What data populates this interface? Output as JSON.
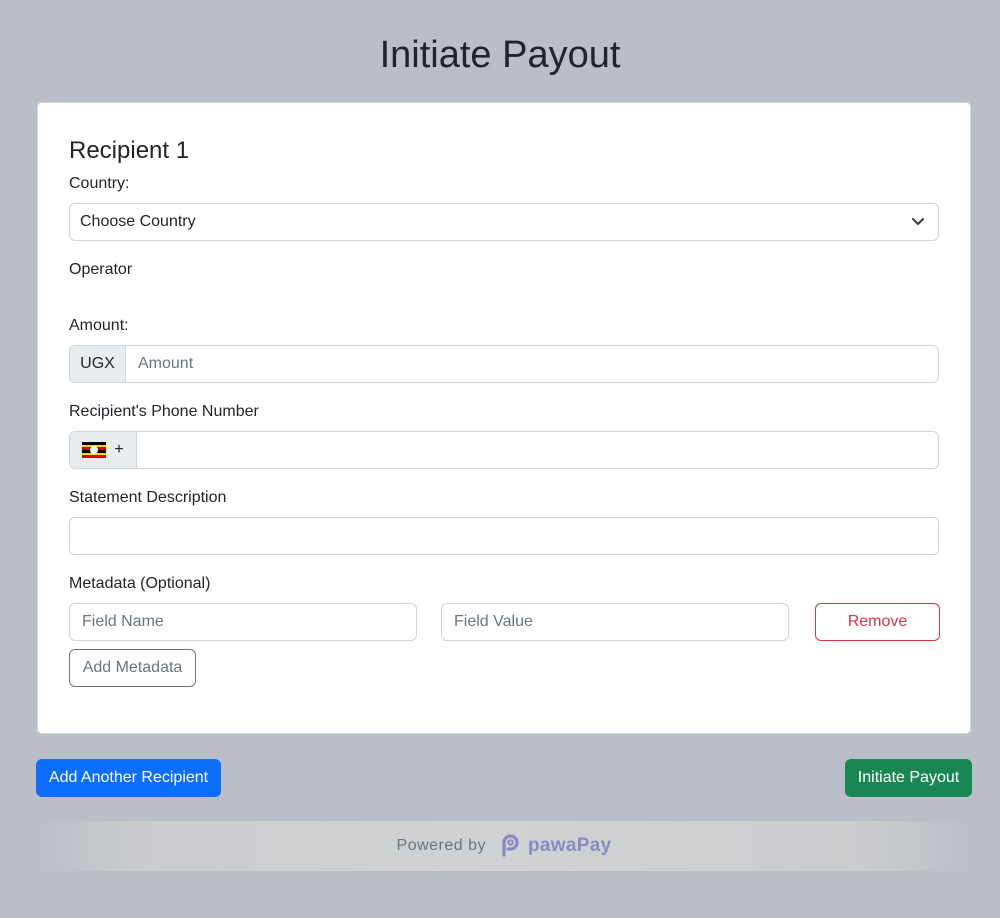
{
  "page": {
    "title": "Initiate Payout"
  },
  "recipient": {
    "heading": "Recipient 1",
    "country_label": "Country:",
    "country_value": "Choose Country",
    "operator_label": "Operator",
    "amount_label": "Amount:",
    "amount_currency": "UGX",
    "amount_placeholder": "Amount",
    "phone_label": "Recipient's Phone Number",
    "phone_prefix": "+",
    "phone_value": "",
    "description_label": "Statement Description",
    "description_value": "",
    "metadata_label": "Metadata (Optional)",
    "field_name_placeholder": "Field Name",
    "field_value_placeholder": "Field Value",
    "remove_label": "Remove",
    "add_metadata_label": "Add Metadata"
  },
  "actions": {
    "add_recipient_label": "Add Another Recipient",
    "initiate_label": "Initiate Payout"
  },
  "footer": {
    "powered_by": "Powered by",
    "brand": "pawaPay"
  },
  "colors": {
    "background": "#babec6",
    "primary": "#0d6efd",
    "success": "#198754",
    "danger": "#dc3545",
    "brand": "#8a8ac0"
  },
  "icons": {
    "select": "chevron-down-icon",
    "flag": "uganda-flag-icon",
    "brand": "pawapay-logo-icon"
  }
}
